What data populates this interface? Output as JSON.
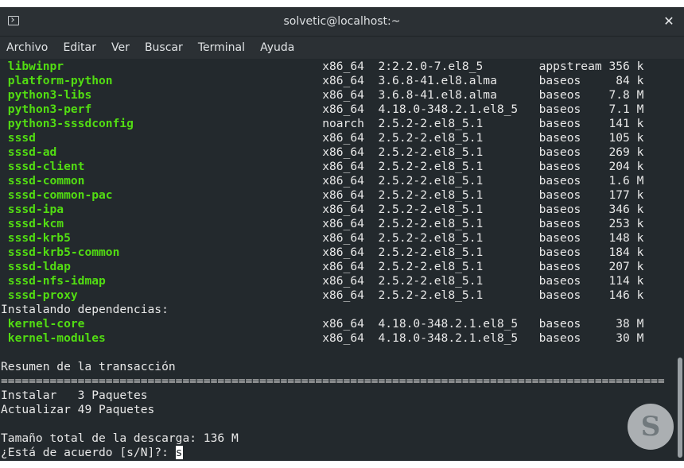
{
  "window": {
    "title": "solvetic@localhost:~",
    "close_glyph": "✕"
  },
  "menu": [
    "Archivo",
    "Editar",
    "Ver",
    "Buscar",
    "Terminal",
    "Ayuda"
  ],
  "packages": [
    [
      "libwinpr",
      "x86_64",
      "2:2.2.0-7.el8_5",
      "appstream",
      "356 k"
    ],
    [
      "platform-python",
      "x86_64",
      "3.6.8-41.el8.alma",
      "baseos",
      "84 k"
    ],
    [
      "python3-libs",
      "x86_64",
      "3.6.8-41.el8.alma",
      "baseos",
      "7.8 M"
    ],
    [
      "python3-perf",
      "x86_64",
      "4.18.0-348.2.1.el8_5",
      "baseos",
      "7.1 M"
    ],
    [
      "python3-sssdconfig",
      "noarch",
      "2.5.2-2.el8_5.1",
      "baseos",
      "141 k"
    ],
    [
      "sssd",
      "x86_64",
      "2.5.2-2.el8_5.1",
      "baseos",
      "105 k"
    ],
    [
      "sssd-ad",
      "x86_64",
      "2.5.2-2.el8_5.1",
      "baseos",
      "269 k"
    ],
    [
      "sssd-client",
      "x86_64",
      "2.5.2-2.el8_5.1",
      "baseos",
      "204 k"
    ],
    [
      "sssd-common",
      "x86_64",
      "2.5.2-2.el8_5.1",
      "baseos",
      "1.6 M"
    ],
    [
      "sssd-common-pac",
      "x86_64",
      "2.5.2-2.el8_5.1",
      "baseos",
      "177 k"
    ],
    [
      "sssd-ipa",
      "x86_64",
      "2.5.2-2.el8_5.1",
      "baseos",
      "346 k"
    ],
    [
      "sssd-kcm",
      "x86_64",
      "2.5.2-2.el8_5.1",
      "baseos",
      "253 k"
    ],
    [
      "sssd-krb5",
      "x86_64",
      "2.5.2-2.el8_5.1",
      "baseos",
      "148 k"
    ],
    [
      "sssd-krb5-common",
      "x86_64",
      "2.5.2-2.el8_5.1",
      "baseos",
      "184 k"
    ],
    [
      "sssd-ldap",
      "x86_64",
      "2.5.2-2.el8_5.1",
      "baseos",
      "207 k"
    ],
    [
      "sssd-nfs-idmap",
      "x86_64",
      "2.5.2-2.el8_5.1",
      "baseos",
      "114 k"
    ],
    [
      "sssd-proxy",
      "x86_64",
      "2.5.2-2.el8_5.1",
      "baseos",
      "146 k"
    ]
  ],
  "deps_header": "Instalando dependencias:",
  "dependencies": [
    [
      "kernel-core",
      "x86_64",
      "4.18.0-348.2.1.el8_5",
      "baseos",
      "38 M"
    ],
    [
      "kernel-modules",
      "x86_64",
      "4.18.0-348.2.1.el8_5",
      "baseos",
      "30 M"
    ]
  ],
  "summary": {
    "title": "Resumen de la transacción",
    "separator": "===============================================================================================",
    "install_label": "Instalar",
    "install_count": "3 Paquetes",
    "update_label": "Actualizar",
    "update_count": "49 Paquetes",
    "total": "Tamaño total de la descarga: 136 M",
    "prompt": "¿Está de acuerdo [s/N]?: ",
    "input": "s"
  },
  "logo_glyph": "S",
  "colors": {
    "background": "#23292d",
    "package_name": "#52dd12",
    "text": "#e8e8e8"
  }
}
